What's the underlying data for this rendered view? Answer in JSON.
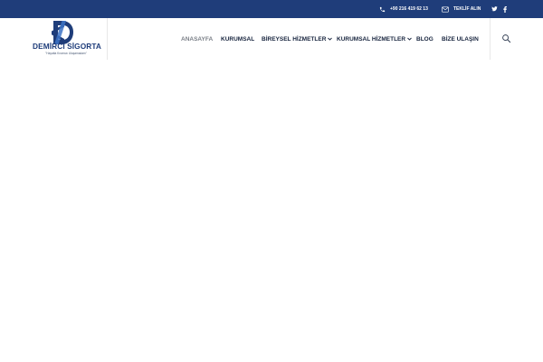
{
  "topbar": {
    "phone": "+90 216 419 62 13",
    "quote_label": "TEKLİF ALIN",
    "social_icons": [
      "twitter-icon",
      "facebook-icon"
    ],
    "background": "#1f3d7a"
  },
  "logo": {
    "brand": "DEMİRCİ SİGORTA",
    "slogan": "\"Hayatta Kıramızı Ulaşamadam\""
  },
  "navigation": {
    "items": [
      "ANASAYFA",
      "KURUMSAL",
      "BİREYSEL HİZMETLER",
      "KURUMSAL HİZMETLER",
      "BLOG",
      "BİZE ULAŞIN"
    ],
    "active": "ANASAYFA"
  },
  "icons": {
    "phone": "phone-icon",
    "quote": "mail-icon",
    "search": "search-icon",
    "dropdown": "chevron-down-icon"
  },
  "colors": {
    "brand": "#1f3d7a",
    "nav_text": "#16233d",
    "active_nav": "#7a7f87",
    "border": "#e8e8e8"
  }
}
